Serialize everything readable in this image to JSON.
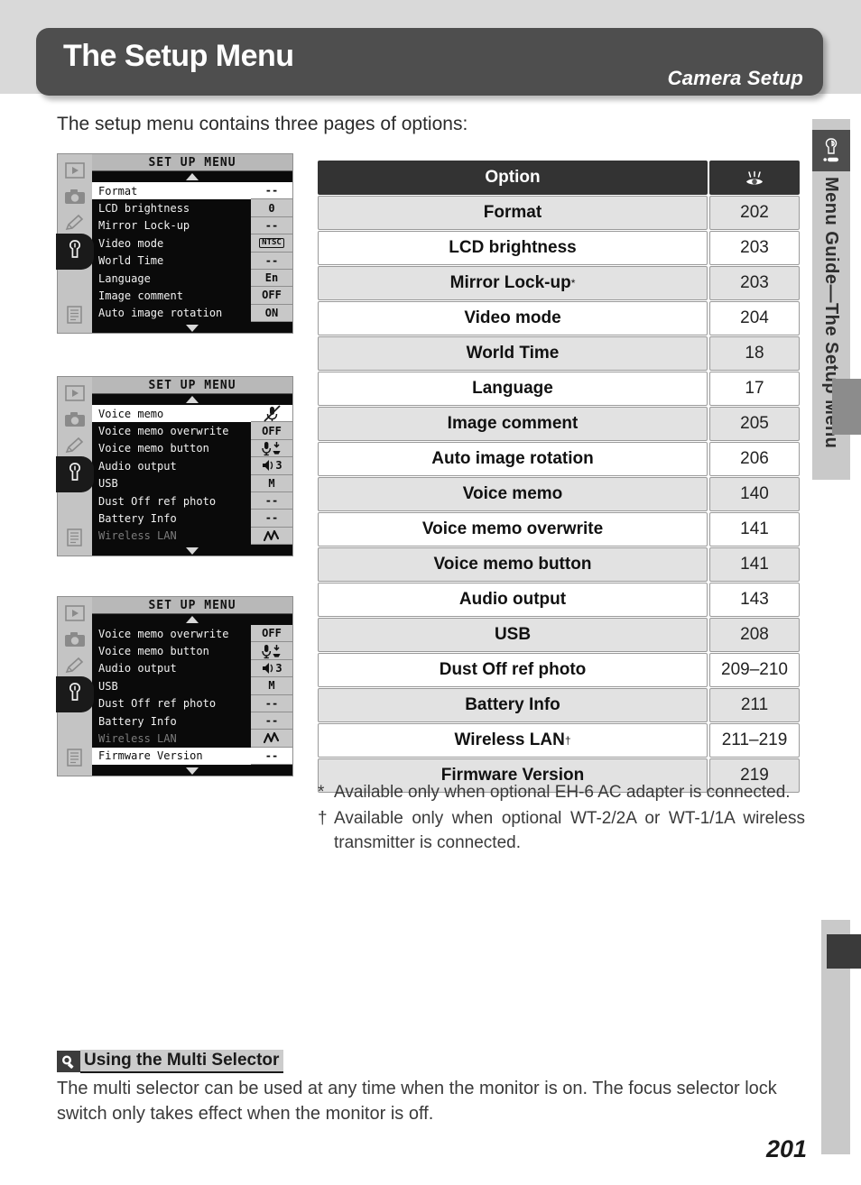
{
  "header": {
    "title": "The Setup Menu",
    "subtitle": "Camera Setup"
  },
  "intro": "The setup menu contains three pages of options:",
  "side_rail": {
    "icon": "wrench-tab-icon",
    "vertical_text": "Menu Guide—The Setup Menu"
  },
  "lcd_screens": [
    {
      "screen_title": "SET UP MENU",
      "up_arrow": "▲",
      "down_arrow": "▼",
      "rows": [
        {
          "label": "Format",
          "value": "--",
          "highlighted": true,
          "dim": false
        },
        {
          "label": "LCD brightness",
          "value": "0",
          "highlighted": false,
          "dim": false
        },
        {
          "label": "Mirror Lock-up",
          "value": "--",
          "highlighted": false,
          "dim": false
        },
        {
          "label": "Video mode",
          "value": "NTSC",
          "highlighted": false,
          "dim": false,
          "boxed": true
        },
        {
          "label": "World Time",
          "value": "--",
          "highlighted": false,
          "dim": false
        },
        {
          "label": "Language",
          "value": "En",
          "highlighted": false,
          "dim": false
        },
        {
          "label": "Image comment",
          "value": "OFF",
          "highlighted": false,
          "dim": false
        },
        {
          "label": "Auto image rotation",
          "value": "ON",
          "highlighted": false,
          "dim": false
        }
      ]
    },
    {
      "screen_title": "SET UP MENU",
      "up_arrow": "▲",
      "down_arrow": "▼",
      "rows": [
        {
          "label": "Voice memo",
          "value": "mic-off-icon",
          "highlighted": true,
          "dim": false,
          "icon": "mic-off"
        },
        {
          "label": "Voice memo overwrite",
          "value": "OFF",
          "highlighted": false,
          "dim": false
        },
        {
          "label": "Voice memo button",
          "value": "mic-press-icon",
          "highlighted": false,
          "dim": false,
          "icon": "mic-press"
        },
        {
          "label": "Audio output",
          "value": "3",
          "highlighted": false,
          "dim": false,
          "icon": "speaker"
        },
        {
          "label": "USB",
          "value": "M",
          "highlighted": false,
          "dim": false
        },
        {
          "label": "Dust Off ref photo",
          "value": "--",
          "highlighted": false,
          "dim": false
        },
        {
          "label": "Battery Info",
          "value": "--",
          "highlighted": false,
          "dim": false
        },
        {
          "label": "Wireless LAN",
          "value": "wireless-icon",
          "highlighted": false,
          "dim": true,
          "icon": "wireless"
        }
      ]
    },
    {
      "screen_title": "SET UP MENU",
      "up_arrow": "▲",
      "down_arrow": "▼",
      "rows": [
        {
          "label": "Voice memo overwrite",
          "value": "OFF",
          "highlighted": false,
          "dim": false
        },
        {
          "label": "Voice memo button",
          "value": "mic-press-icon",
          "highlighted": false,
          "dim": false,
          "icon": "mic-press"
        },
        {
          "label": "Audio output",
          "value": "3",
          "highlighted": false,
          "dim": false,
          "icon": "speaker"
        },
        {
          "label": "USB",
          "value": "M",
          "highlighted": false,
          "dim": false
        },
        {
          "label": "Dust Off ref photo",
          "value": "--",
          "highlighted": false,
          "dim": false
        },
        {
          "label": "Battery Info",
          "value": "--",
          "highlighted": false,
          "dim": false
        },
        {
          "label": "Wireless LAN",
          "value": "wireless-icon",
          "highlighted": false,
          "dim": true,
          "icon": "wireless"
        },
        {
          "label": "Firmware Version",
          "value": "--",
          "highlighted": true,
          "dim": false
        }
      ]
    }
  ],
  "lcd_rail_icons": [
    "playback-icon",
    "camera-icon",
    "pencil-icon",
    "wrench-icon",
    "document-icon"
  ],
  "options_table": {
    "header": {
      "option": "Option",
      "page_icon": "eye-page-reference-icon"
    },
    "rows": [
      {
        "option": "Format",
        "sup": "",
        "page": "202"
      },
      {
        "option": "LCD brightness",
        "sup": "",
        "page": "203"
      },
      {
        "option": "Mirror Lock-up",
        "sup": "*",
        "page": "203"
      },
      {
        "option": "Video mode",
        "sup": "",
        "page": "204"
      },
      {
        "option": "World Time",
        "sup": "",
        "page": "18"
      },
      {
        "option": "Language",
        "sup": "",
        "page": "17"
      },
      {
        "option": "Image comment",
        "sup": "",
        "page": "205"
      },
      {
        "option": "Auto image rotation",
        "sup": "",
        "page": "206"
      },
      {
        "option": "Voice memo",
        "sup": "",
        "page": "140"
      },
      {
        "option": "Voice memo overwrite",
        "sup": "",
        "page": "141"
      },
      {
        "option": "Voice memo button",
        "sup": "",
        "page": "141"
      },
      {
        "option": "Audio output",
        "sup": "",
        "page": "143"
      },
      {
        "option": "USB",
        "sup": "",
        "page": "208"
      },
      {
        "option": "Dust Off ref photo",
        "sup": "",
        "page": "209–210"
      },
      {
        "option": "Battery Info",
        "sup": "",
        "page": "211"
      },
      {
        "option": "Wireless LAN",
        "sup": "†",
        "page": "211–219"
      },
      {
        "option": "Firmware Version",
        "sup": "",
        "page": "219"
      }
    ]
  },
  "footnotes": [
    {
      "mark": "*",
      "text": "Available only when optional EH-6 AC adapter is connected."
    },
    {
      "mark": "†",
      "text": "Available only when optional WT-2/2A or WT-1/1A wireless transmitter is connected."
    }
  ],
  "tip": {
    "icon": "magnifier-icon",
    "title": "Using the Multi Selector",
    "body": "The multi selector can be used at any time when the monitor is on.  The focus selector lock switch only takes effect when the monitor is off."
  },
  "page_number": "201",
  "colors": {
    "title_bar": "#4e4e4e",
    "top_band": "#d9d9d9",
    "table_header": "#333333",
    "table_shade": "#e2e2e2",
    "lcd_bg": "#0a0a0a"
  }
}
